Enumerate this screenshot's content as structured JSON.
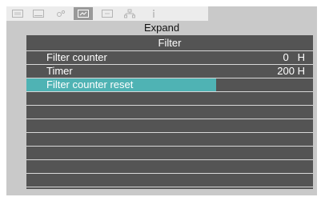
{
  "tabs": [
    {
      "icon": "display-icon"
    },
    {
      "icon": "screen-icon"
    },
    {
      "icon": "color-icon"
    },
    {
      "icon": "setting-icon",
      "active": true
    },
    {
      "icon": "expand-icon"
    },
    {
      "icon": "network-icon"
    },
    {
      "icon": "info-icon"
    }
  ],
  "header": {
    "title": "Expand"
  },
  "menu": {
    "title": "Filter",
    "rows": [
      {
        "label": "Filter counter",
        "value": "0   H"
      },
      {
        "label": "Timer",
        "value": "200 H"
      },
      {
        "label": "Filter counter reset",
        "value": "",
        "selected": true
      },
      {
        "label": "",
        "value": ""
      },
      {
        "label": "",
        "value": ""
      },
      {
        "label": "",
        "value": ""
      },
      {
        "label": "",
        "value": ""
      },
      {
        "label": "",
        "value": ""
      },
      {
        "label": "",
        "value": ""
      },
      {
        "label": "",
        "value": ""
      }
    ]
  },
  "colors": {
    "menu_bg": "#545454",
    "highlight": "#4fb3b4",
    "frame": "#c9c9c9",
    "tabbar": "#ececec"
  }
}
